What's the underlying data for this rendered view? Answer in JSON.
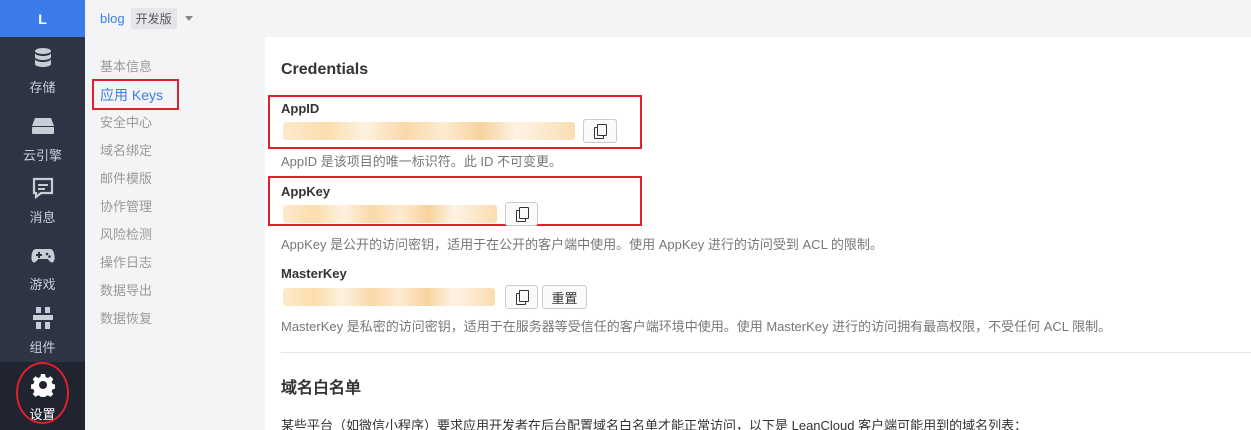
{
  "rail": {
    "logo": "L",
    "items": [
      {
        "label": "存储",
        "icon": "database-icon"
      },
      {
        "label": "云引擎",
        "icon": "cloud-engine-icon"
      },
      {
        "label": "消息",
        "icon": "message-icon"
      },
      {
        "label": "游戏",
        "icon": "gamepad-icon"
      },
      {
        "label": "组件",
        "icon": "components-icon"
      },
      {
        "label": "设置",
        "icon": "gear-icon",
        "active": true
      }
    ]
  },
  "topbar": {
    "app_name": "blog",
    "plan": "开发版"
  },
  "submenu": {
    "items": [
      "基本信息",
      "应用 Keys",
      "安全中心",
      "域名绑定",
      "邮件模版",
      "协作管理",
      "风险检测",
      "操作日志",
      "数据导出",
      "数据恢复"
    ],
    "active_index": 1
  },
  "main": {
    "credentials_title": "Credentials",
    "appid": {
      "label": "AppID",
      "help": "AppID 是该项目的唯一标识符。此 ID 不可变更。"
    },
    "appkey": {
      "label": "AppKey",
      "help": "AppKey 是公开的访问密钥，适用于在公开的客户端中使用。使用 AppKey 进行的访问受到 ACL 的限制。"
    },
    "masterkey": {
      "label": "MasterKey",
      "reset_label": "重置",
      "help": "MasterKey 是私密的访问密钥，适用于在服务器等受信任的客户端环境中使用。使用 MasterKey 进行的访问拥有最高权限，不受任何 ACL 限制。"
    },
    "domain_title": "域名白名单",
    "domain_desc": "某些平台（如微信小程序）要求应用开发者在后台配置域名白名单才能正常访问，以下是 LeanCloud 客户端可能用到的域名列表："
  },
  "colors": {
    "accent": "#3c7ce8",
    "rail_bg": "#2d3444",
    "annotation": "#e0202a"
  }
}
